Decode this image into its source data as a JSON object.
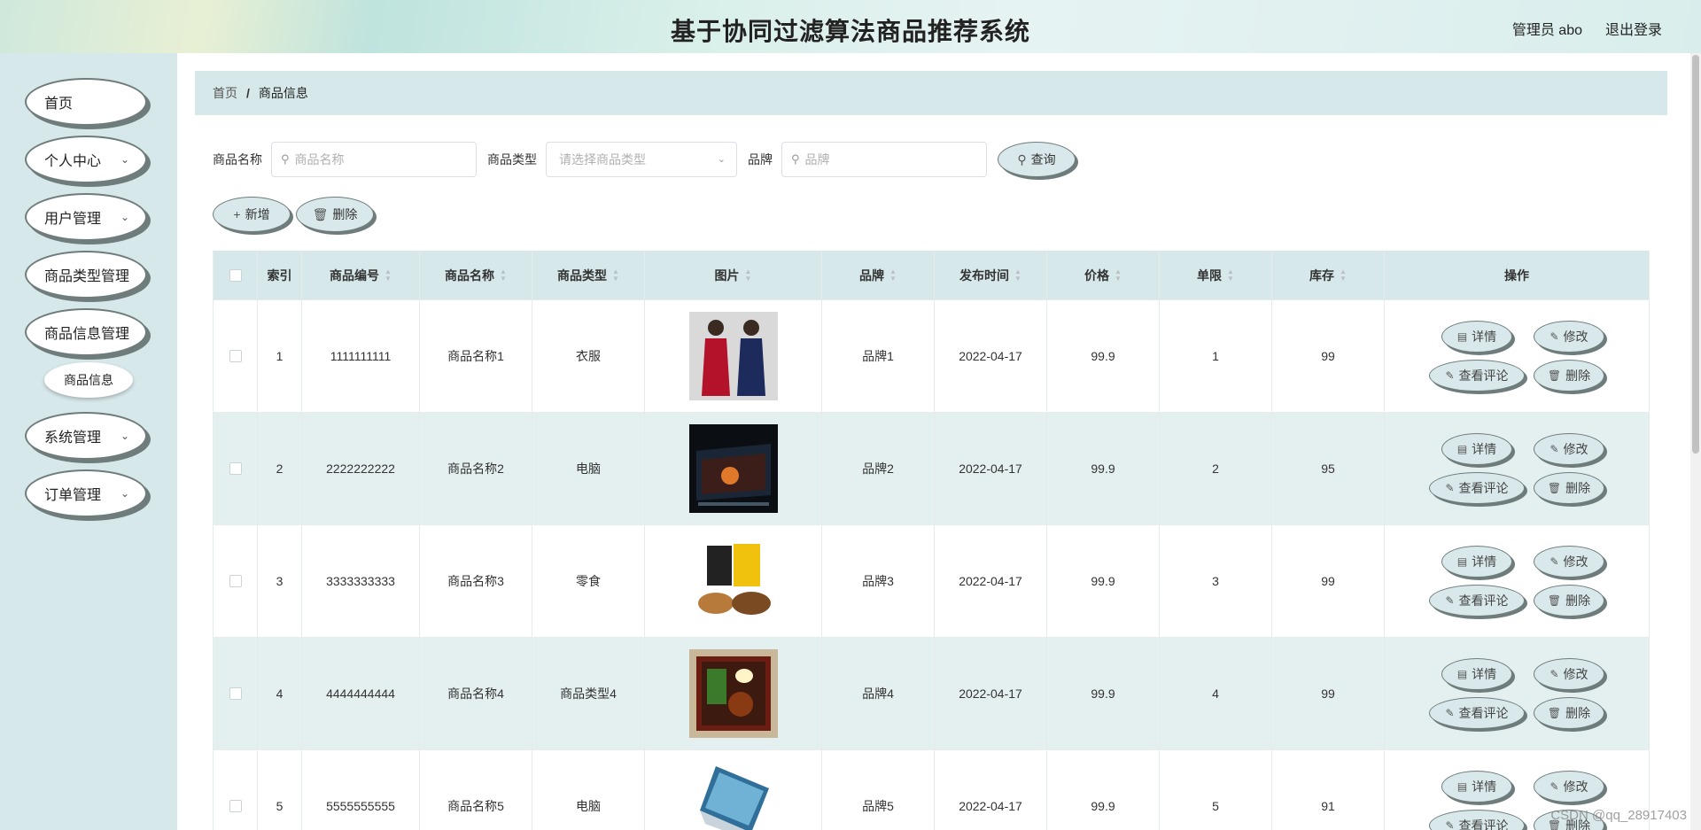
{
  "header": {
    "title": "基于协同过滤算法商品推荐系统",
    "user": "管理员 abo",
    "logout": "退出登录"
  },
  "sidebar": {
    "items": [
      {
        "label": "首页",
        "has_children": false
      },
      {
        "label": "个人中心",
        "has_children": true
      },
      {
        "label": "用户管理",
        "has_children": true
      },
      {
        "label": "商品类型管理",
        "has_children": true
      },
      {
        "label": "商品信息管理",
        "has_children": true
      },
      {
        "label": "系统管理",
        "has_children": true
      },
      {
        "label": "订单管理",
        "has_children": true
      }
    ],
    "subitem": "商品信息"
  },
  "breadcrumb": {
    "home": "首页",
    "separator": "/",
    "current": "商品信息"
  },
  "search": {
    "name_label": "商品名称",
    "name_placeholder": "商品名称",
    "type_label": "商品类型",
    "type_placeholder": "请选择商品类型",
    "brand_label": "品牌",
    "brand_placeholder": "品牌",
    "query_button": "查询"
  },
  "actions": {
    "add": "新增",
    "delete": "删除"
  },
  "table": {
    "columns": [
      "索引",
      "商品编号",
      "商品名称",
      "商品类型",
      "图片",
      "品牌",
      "发布时间",
      "价格",
      "单限",
      "库存",
      "操作"
    ],
    "rows": [
      {
        "index": "1",
        "code": "1111111111",
        "name": "商品名称1",
        "type": "衣服",
        "image": "clothing-photo",
        "brand": "品牌1",
        "date": "2022-04-17",
        "price": "99.9",
        "limit": "1",
        "stock": "99"
      },
      {
        "index": "2",
        "code": "2222222222",
        "name": "商品名称2",
        "type": "电脑",
        "image": "laptop-photo",
        "brand": "品牌2",
        "date": "2022-04-17",
        "price": "99.9",
        "limit": "2",
        "stock": "95"
      },
      {
        "index": "3",
        "code": "3333333333",
        "name": "商品名称3",
        "type": "零食",
        "image": "snack-photo",
        "brand": "品牌3",
        "date": "2022-04-17",
        "price": "99.9",
        "limit": "3",
        "stock": "99"
      },
      {
        "index": "4",
        "code": "4444444444",
        "name": "商品名称4",
        "type": "商品类型4",
        "image": "food-box-photo",
        "brand": "品牌4",
        "date": "2022-04-17",
        "price": "99.9",
        "limit": "4",
        "stock": "99"
      },
      {
        "index": "5",
        "code": "5555555555",
        "name": "商品名称5",
        "type": "电脑",
        "image": "laptop-photo",
        "brand": "品牌5",
        "date": "2022-04-17",
        "price": "99.9",
        "limit": "5",
        "stock": "91"
      }
    ],
    "row_ops": {
      "detail": "详情",
      "edit": "修改",
      "reviews": "查看评论",
      "delete": "删除"
    }
  },
  "watermark": "CSDN @qq_28917403",
  "colors": {
    "accent_bg": "#d7e8ea",
    "stripe": "#e4eff0",
    "outline": "#6f7c7c"
  }
}
